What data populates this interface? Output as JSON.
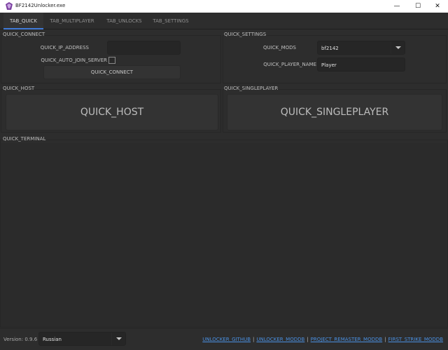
{
  "window": {
    "title": "BF2142Unlocker.exe",
    "minimize_glyph": "—",
    "maximize_glyph": "☐",
    "close_glyph": "✕"
  },
  "tabs": [
    {
      "label": "TAB_QUICK",
      "active": true
    },
    {
      "label": "TAB_MULTIPLAYER",
      "active": false
    },
    {
      "label": "TAB_UNLOCKS",
      "active": false
    },
    {
      "label": "TAB_SETTINGS",
      "active": false
    }
  ],
  "quick_connect": {
    "group_title": "QUICK_CONNECT",
    "ip_label": "QUICK_IP_ADDRESS",
    "ip_value": "",
    "auto_join_label": "QUICK_AUTO_JOIN_SERVER",
    "auto_join_checked": false,
    "connect_button": "QUICK_CONNECT"
  },
  "quick_settings": {
    "group_title": "QUICK_SETTINGS",
    "mods_label": "QUICK_MODS",
    "mods_value": "bf2142",
    "player_name_label": "QUICK_PLAYER_NAME",
    "player_name_value": "Player"
  },
  "quick_host": {
    "group_title": "QUICK_HOST",
    "button": "QUICK_HOST"
  },
  "quick_singleplayer": {
    "group_title": "QUICK_SINGLEPLAYER",
    "button": "QUICK_SINGLEPLAYER"
  },
  "quick_terminal": {
    "group_title": "QUICK_TERMINAL",
    "content": ""
  },
  "footer": {
    "version_label": "Version:",
    "version_value": "0.9.6",
    "language_value": "Russian",
    "links": [
      "UNLOCKER_GITHUB",
      "UNLOCKER_MODDB",
      "PROJECT_REMASTER_MODDB",
      "FIRST_STRIKE_MODDB"
    ],
    "separator": "|"
  },
  "colors": {
    "background": "#2d2d2d",
    "accent": "#3f79d6",
    "link": "#4a90e2"
  }
}
